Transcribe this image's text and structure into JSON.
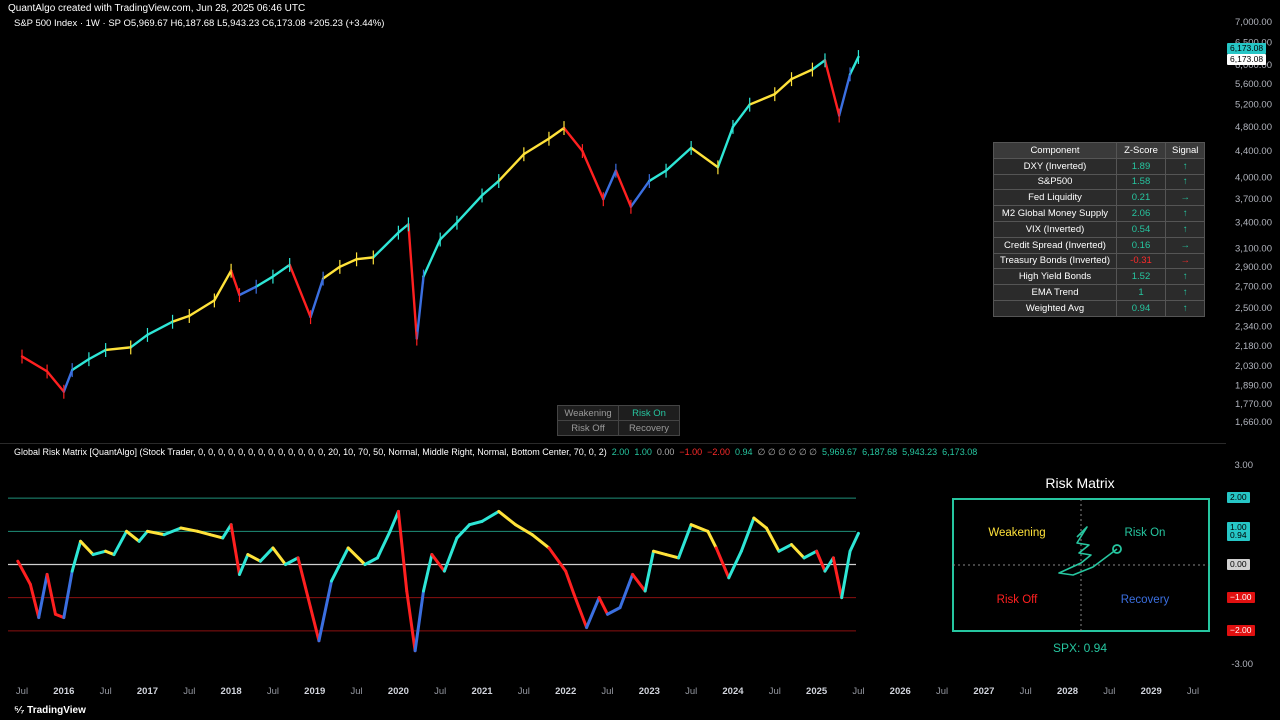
{
  "header": {
    "credit": "QuantAlgo created with TradingView.com, Jun 28, 2025 06:46 UTC"
  },
  "symbol": {
    "line": "S&P 500 Index · 1W · SP  O5,969.67  H6,187.68  L5,943.23  C6,173.08  +205.23 (+3.44%)"
  },
  "indicator": {
    "title": "Global Risk Matrix [QuantAlgo] (Stock Trader, 0, 0, 0, 0, 0, 0, 0, 0, 0, 0, 0, 0, 0, 20, 10, 70, 50, Normal, Middle Right, Normal, Bottom Center, 70, 0, 2)",
    "values": [
      {
        "text": "2.00",
        "color": "#26c6a0"
      },
      {
        "text": "1.00",
        "color": "#26c6a0"
      },
      {
        "text": "0.00",
        "color": "#aaaaaa"
      },
      {
        "text": "−1.00",
        "color": "#ff2a2a"
      },
      {
        "text": "−2.00",
        "color": "#ff2a2a"
      },
      {
        "text": "0.94",
        "color": "#26c6a0"
      },
      {
        "text": "∅ ∅ ∅ ∅ ∅ ∅",
        "color": "#aaaaaa"
      },
      {
        "text": "5,969.67",
        "color": "#26c6a0"
      },
      {
        "text": "6,187.68",
        "color": "#26c6a0"
      },
      {
        "text": "5,943.23",
        "color": "#26c6a0"
      },
      {
        "text": "6,173.08",
        "color": "#26c6a0"
      }
    ]
  },
  "colors": {
    "risk_on": "#2ee6d6",
    "weakening": "#ffe23a",
    "risk_off": "#ff2020",
    "recovery": "#3b6fe0",
    "teal": "#26c6a0"
  },
  "table": {
    "headers": [
      "Component",
      "Z-Score",
      "Signal"
    ],
    "rows": [
      {
        "component": "DXY (Inverted)",
        "z": "1.89",
        "signal": "↑",
        "color": "#26c6a0"
      },
      {
        "component": "S&P500",
        "z": "1.58",
        "signal": "↑",
        "color": "#26c6a0"
      },
      {
        "component": "Fed Liquidity",
        "z": "0.21",
        "signal": "→",
        "color": "#26c6a0"
      },
      {
        "component": "M2 Global Money Supply",
        "z": "2.06",
        "signal": "↑",
        "color": "#26c6a0"
      },
      {
        "component": "VIX (Inverted)",
        "z": "0.54",
        "signal": "↑",
        "color": "#26c6a0"
      },
      {
        "component": "Credit Spread (Inverted)",
        "z": "0.16",
        "signal": "→",
        "color": "#26c6a0"
      },
      {
        "component": "Treasury Bonds (Inverted)",
        "z": "-0.31",
        "signal": "→",
        "color": "#ff2a2a"
      },
      {
        "component": "High Yield Bonds",
        "z": "1.52",
        "signal": "↑",
        "color": "#26c6a0"
      },
      {
        "component": "EMA Trend",
        "z": "1",
        "signal": "↑",
        "color": "#26c6a0"
      },
      {
        "component": "Weighted Avg",
        "z": "0.94",
        "signal": "↑",
        "color": "#26c6a0"
      }
    ]
  },
  "quad_legend": {
    "weakening": "Weakening",
    "risk_on": "Risk On",
    "risk_off": "Risk Off",
    "recovery": "Recovery"
  },
  "matrix": {
    "title": "Risk Matrix",
    "weakening": "Weakening",
    "risk_on": "Risk On",
    "risk_off": "Risk Off",
    "recovery": "Recovery",
    "spx": "SPX: 0.94"
  },
  "price_badges": {
    "teal": "6,173.08",
    "white": "6,173.08"
  },
  "osc_badges": [
    {
      "text": "2.00",
      "value": 2.0,
      "bg": "#26c6c6",
      "fg": "#000"
    },
    {
      "text": "1.00",
      "value": 1.1,
      "bg": "#26c6c6",
      "fg": "#000"
    },
    {
      "text": "0.94",
      "value": 0.85,
      "bg": "#26c6c6",
      "fg": "#000"
    },
    {
      "text": "0.00",
      "value": 0.0,
      "bg": "#d0d0d0",
      "fg": "#000"
    },
    {
      "text": "−1.00",
      "value": -1.0,
      "bg": "#e01010",
      "fg": "#fff"
    },
    {
      "text": "−2.00",
      "value": -2.0,
      "bg": "#e01010",
      "fg": "#fff"
    }
  ],
  "footer": {
    "brand": "TradingView"
  },
  "chart_data": [
    {
      "type": "line",
      "title": "S&P 500 Index · 1W · SP",
      "y_scale": "log",
      "ylim": [
        1600,
        7000
      ],
      "y_ticks": [
        "7,000.00",
        "6,500.00",
        "6,000.00",
        "5,600.00",
        "5,200.00",
        "4,800.00",
        "4,400.00",
        "4,000.00",
        "3,700.00",
        "3,400.00",
        "3,100.00",
        "2,900.00",
        "2,700.00",
        "2,500.00",
        "2,340.00",
        "2,180.00",
        "2,030.00",
        "1,890.00",
        "1,770.00",
        "1,660.00"
      ],
      "y_tick_values": [
        7000,
        6500,
        6000,
        5600,
        5200,
        4800,
        4400,
        4000,
        3700,
        3400,
        3100,
        2900,
        2700,
        2500,
        2340,
        2180,
        2030,
        1890,
        1770,
        1660
      ],
      "x_ticks": [
        "Jul",
        "2016",
        "Jul",
        "2017",
        "Jul",
        "2018",
        "Jul",
        "2019",
        "Jul",
        "2020",
        "Jul",
        "2021",
        "Jul",
        "2022",
        "Jul",
        "2023",
        "Jul",
        "2024",
        "Jul",
        "2025",
        "Jul",
        "2026",
        "Jul",
        "2027",
        "Jul",
        "2028",
        "Jul",
        "2029",
        "Jul"
      ],
      "x": [
        2015.5,
        2015.8,
        2016.0,
        2016.1,
        2016.3,
        2016.5,
        2016.8,
        2017.0,
        2017.3,
        2017.5,
        2017.8,
        2018.0,
        2018.1,
        2018.3,
        2018.5,
        2018.7,
        2018.95,
        2019.1,
        2019.3,
        2019.5,
        2019.7,
        2020.0,
        2020.12,
        2020.22,
        2020.3,
        2020.5,
        2020.7,
        2021.0,
        2021.2,
        2021.5,
        2021.8,
        2021.98,
        2022.2,
        2022.45,
        2022.6,
        2022.78,
        2023.0,
        2023.2,
        2023.5,
        2023.82,
        2024.0,
        2024.2,
        2024.5,
        2024.7,
        2024.95,
        2025.1,
        2025.27,
        2025.4,
        2025.5
      ],
      "values": [
        2100,
        1990,
        1850,
        2000,
        2080,
        2150,
        2170,
        2270,
        2380,
        2430,
        2570,
        2860,
        2620,
        2700,
        2800,
        2920,
        2420,
        2780,
        2900,
        2980,
        3000,
        3280,
        3380,
        2240,
        2800,
        3200,
        3400,
        3750,
        3950,
        4350,
        4600,
        4780,
        4400,
        3700,
        4100,
        3600,
        3950,
        4100,
        4450,
        4150,
        4800,
        5200,
        5400,
        5700,
        5900,
        6100,
        5000,
        5800,
        6173.08
      ],
      "series_colors": [
        "risk_off",
        "risk_off",
        "risk_off",
        "recovery",
        "risk_on",
        "risk_on",
        "weakening",
        "risk_on",
        "risk_on",
        "weakening",
        "weakening",
        "weakening",
        "risk_off",
        "recovery",
        "risk_on",
        "risk_on",
        "risk_off",
        "recovery",
        "weakening",
        "weakening",
        "weakening",
        "risk_on",
        "risk_on",
        "risk_off",
        "recovery",
        "risk_on",
        "risk_on",
        "risk_on",
        "risk_on",
        "weakening",
        "weakening",
        "weakening",
        "risk_off",
        "risk_off",
        "recovery",
        "risk_off",
        "recovery",
        "risk_on",
        "risk_on",
        "weakening",
        "risk_on",
        "risk_on",
        "weakening",
        "weakening",
        "weakening",
        "risk_on",
        "risk_off",
        "recovery",
        "risk_on"
      ],
      "open": 5969.67,
      "high": 6187.68,
      "low": 5943.23,
      "close": 6173.08
    },
    {
      "type": "line",
      "title": "Global Risk Matrix [QuantAlgo]",
      "ylim": [
        -3,
        3
      ],
      "y_ticks": [
        "3.00",
        "-3.00"
      ],
      "y_tick_values": [
        3,
        -3
      ],
      "reference_lines": [
        2,
        1,
        0,
        -1,
        -2
      ],
      "x": [
        2015.45,
        2015.6,
        2015.7,
        2015.8,
        2015.9,
        2016.0,
        2016.1,
        2016.2,
        2016.35,
        2016.5,
        2016.6,
        2016.75,
        2016.9,
        2017.0,
        2017.2,
        2017.4,
        2017.6,
        2017.75,
        2017.9,
        2018.0,
        2018.1,
        2018.2,
        2018.35,
        2018.5,
        2018.65,
        2018.8,
        2018.95,
        2019.05,
        2019.2,
        2019.4,
        2019.6,
        2019.75,
        2019.9,
        2020.0,
        2020.1,
        2020.2,
        2020.3,
        2020.4,
        2020.55,
        2020.7,
        2020.85,
        2021.0,
        2021.2,
        2021.4,
        2021.6,
        2021.8,
        2022.0,
        2022.1,
        2022.25,
        2022.4,
        2022.5,
        2022.65,
        2022.8,
        2022.95,
        2023.05,
        2023.2,
        2023.35,
        2023.5,
        2023.7,
        2023.8,
        2023.95,
        2024.1,
        2024.25,
        2024.4,
        2024.55,
        2024.7,
        2024.85,
        2025.0,
        2025.1,
        2025.2,
        2025.3,
        2025.4,
        2025.5
      ],
      "values": [
        0.1,
        -0.6,
        -1.6,
        -0.3,
        -1.5,
        -1.6,
        -0.2,
        0.7,
        0.3,
        0.4,
        0.3,
        1.0,
        0.7,
        1.0,
        0.9,
        1.1,
        1.0,
        0.9,
        0.8,
        1.2,
        -0.3,
        0.3,
        0.1,
        0.5,
        0.0,
        0.2,
        -1.3,
        -2.3,
        -0.5,
        0.5,
        0.0,
        0.2,
        1.0,
        1.6,
        -0.8,
        -2.6,
        -0.8,
        0.3,
        -0.2,
        0.8,
        1.2,
        1.3,
        1.6,
        1.2,
        0.9,
        0.5,
        -0.2,
        -0.9,
        -1.9,
        -1.0,
        -1.5,
        -1.3,
        -0.3,
        -0.8,
        0.4,
        0.3,
        0.2,
        1.2,
        1.0,
        0.5,
        -0.4,
        0.4,
        1.4,
        1.1,
        0.4,
        0.6,
        0.2,
        0.4,
        -0.2,
        0.2,
        -1.0,
        0.4,
        0.94
      ],
      "current": 0.94
    },
    {
      "type": "scatter",
      "title": "Risk Matrix",
      "quadrants": [
        "Weakening",
        "Risk On",
        "Risk Off",
        "Recovery"
      ],
      "trail": [
        [
          -0.1,
          0.7
        ],
        [
          0.15,
          0.95
        ],
        [
          -0.1,
          0.55
        ],
        [
          0.2,
          0.5
        ],
        [
          -0.05,
          0.3
        ],
        [
          0.25,
          0.25
        ],
        [
          0.0,
          0.05
        ],
        [
          -0.55,
          -0.2
        ],
        [
          -0.2,
          -0.25
        ],
        [
          0.3,
          -0.05
        ],
        [
          0.9,
          0.4
        ]
      ],
      "current_point": [
        0.9,
        0.4
      ]
    }
  ]
}
